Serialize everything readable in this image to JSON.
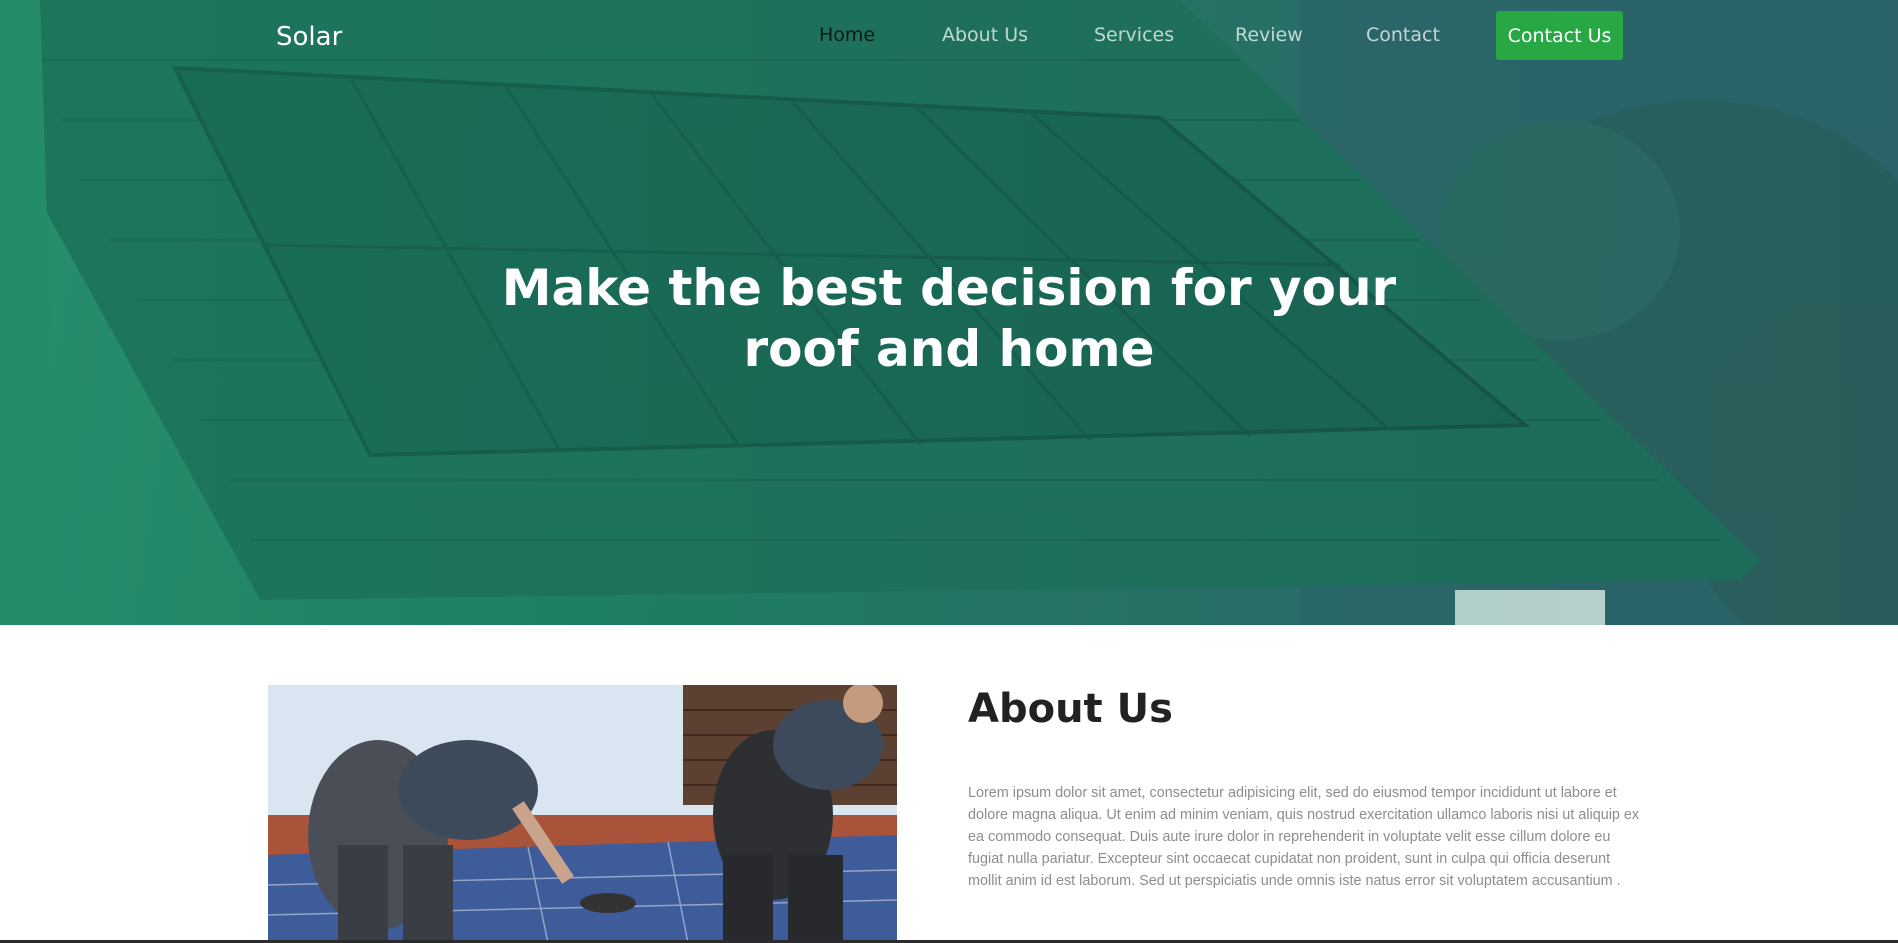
{
  "nav": {
    "brand": "Solar",
    "links": [
      "Home",
      "About Us",
      "Services",
      "Review",
      "Contact"
    ],
    "active": "Home",
    "cta": "Contact Us"
  },
  "hero": {
    "headline_pre": "Make the ",
    "headline_bold": "best decision",
    "headline_post": " for your roof and home"
  },
  "about": {
    "title": "About Us",
    "text": "Lorem ipsum dolor sit amet, consectetur adipisicing elit, sed do eiusmod tempor incididunt ut labore et dolore magna aliqua. Ut enim ad minim veniam, quis nostrud exercitation ullamco laboris nisi ut aliquip ex ea commodo consequat. Duis aute irure dolor in reprehenderit in voluptate velit esse cillum dolore eu fugiat nulla pariatur. Excepteur sint occaecat cupidatat non proident, sunt in culpa qui officia deserunt mollit anim id est laborum. Sed ut perspiciatis unde omnis iste natus error sit voluptatem accusantium ."
  },
  "colors": {
    "accent": "#28a745",
    "hero_tint": "#1f7a60"
  }
}
